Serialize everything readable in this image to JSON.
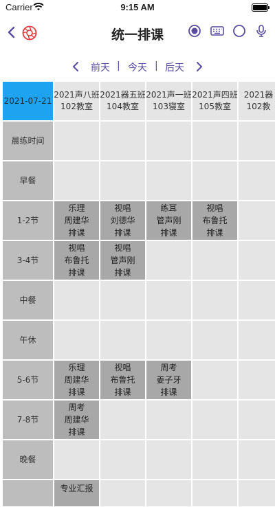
{
  "status": {
    "carrier": "Carrier",
    "time": "9:15 AM"
  },
  "nav": {
    "title": "统一排课"
  },
  "date_nav": {
    "prev": "前天",
    "today": "今天",
    "next": "后天",
    "sep": "|"
  },
  "schedule": {
    "date": "2021-07-21",
    "classes": [
      {
        "name": "2021声八班",
        "room": "102教室"
      },
      {
        "name": "2021器五班",
        "room": "104教室"
      },
      {
        "name": "2021声一班",
        "room": "103寝室"
      },
      {
        "name": "2021声四班",
        "room": "105教室"
      },
      {
        "name": "2021器",
        "room": "102教"
      }
    ],
    "periods": [
      "晨练时间",
      "早餐",
      "1-2节",
      "3-4节",
      "中餐",
      "午休",
      "5-6节",
      "7-8节",
      "晚餐"
    ],
    "entries": [
      [
        "",
        "",
        "",
        "",
        ""
      ],
      [
        "",
        "",
        "",
        "",
        ""
      ],
      [
        {
          "course": "乐理",
          "teacher": "周建华",
          "status": "排课"
        },
        {
          "course": "视唱",
          "teacher": "刘德华",
          "status": "排课"
        },
        {
          "course": "练耳",
          "teacher": "管声刚",
          "status": "排课"
        },
        {
          "course": "视唱",
          "teacher": "布鲁托",
          "status": "排课"
        },
        ""
      ],
      [
        {
          "course": "视唱",
          "teacher": "布鲁托",
          "status": "排课"
        },
        {
          "course": "视唱",
          "teacher": "管声刚",
          "status": "排课"
        },
        "",
        "",
        ""
      ],
      [
        "",
        "",
        "",
        "",
        ""
      ],
      [
        "",
        "",
        "",
        "",
        ""
      ],
      [
        {
          "course": "乐理",
          "teacher": "周建华",
          "status": "排课"
        },
        {
          "course": "视唱",
          "teacher": "布鲁托",
          "status": "排课"
        },
        {
          "course": "周考",
          "teacher": "姜子牙",
          "status": "排课"
        },
        "",
        ""
      ],
      [
        {
          "course": "周考",
          "teacher": "周建华",
          "status": "排课"
        },
        "",
        "",
        "",
        ""
      ],
      [
        "",
        "",
        "",
        "",
        ""
      ]
    ],
    "partial_row_text": "专业汇报"
  },
  "colors": {
    "accent": "#5a4aa0",
    "date_header": "#1da3f0",
    "filled_cell": "#a8a8a8",
    "row_header": "#bdbdbd",
    "empty_cell": "#e5e5e5"
  },
  "icons": [
    "chevron-left-icon",
    "aperture-logo-icon",
    "radio-selected-icon",
    "keyboard-icon",
    "radio-empty-icon",
    "microphone-icon"
  ]
}
